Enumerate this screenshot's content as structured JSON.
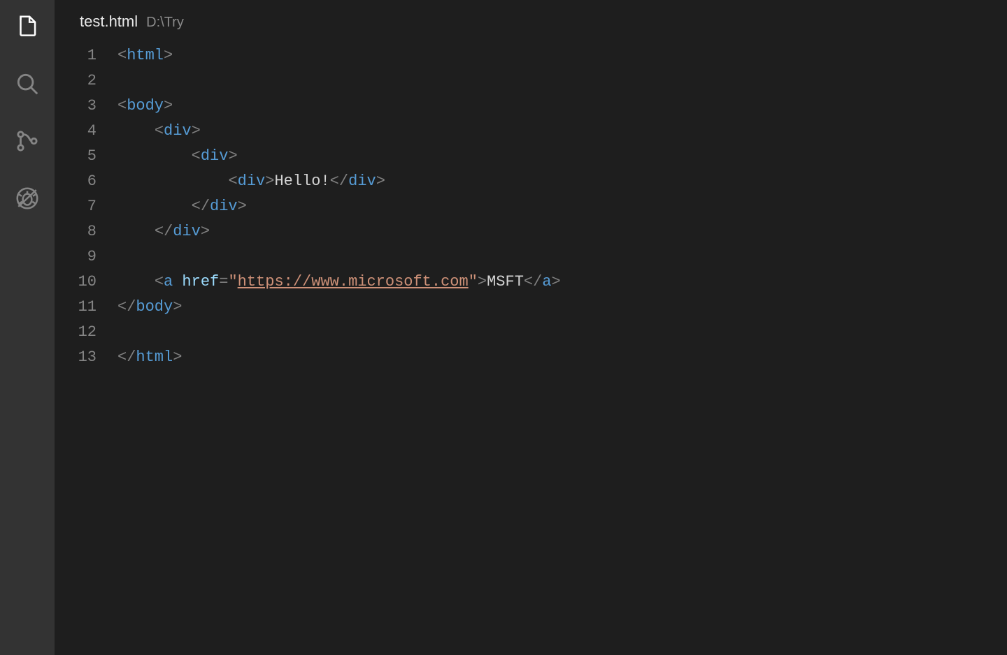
{
  "activityBar": {
    "items": [
      {
        "name": "files-icon",
        "active": true
      },
      {
        "name": "search-icon",
        "active": false
      },
      {
        "name": "scm-icon",
        "active": false
      },
      {
        "name": "debug-icon",
        "active": false
      }
    ]
  },
  "editor": {
    "tab": {
      "filename": "test.html",
      "path": "D:\\Try"
    },
    "lineNumbers": [
      "1",
      "2",
      "3",
      "4",
      "5",
      "6",
      "7",
      "8",
      "9",
      "10",
      "11",
      "12",
      "13"
    ],
    "code": {
      "lines": [
        [
          {
            "t": "p",
            "v": "<"
          },
          {
            "t": "tg",
            "v": "html"
          },
          {
            "t": "p",
            "v": ">"
          }
        ],
        [],
        [
          {
            "t": "p",
            "v": "<"
          },
          {
            "t": "tg",
            "v": "body"
          },
          {
            "t": "p",
            "v": ">"
          }
        ],
        [
          {
            "t": "tx",
            "v": "    "
          },
          {
            "t": "p",
            "v": "<"
          },
          {
            "t": "tg",
            "v": "div"
          },
          {
            "t": "p",
            "v": ">"
          }
        ],
        [
          {
            "t": "tx",
            "v": "        "
          },
          {
            "t": "p",
            "v": "<"
          },
          {
            "t": "tg",
            "v": "div"
          },
          {
            "t": "p",
            "v": ">"
          }
        ],
        [
          {
            "t": "tx",
            "v": "            "
          },
          {
            "t": "p",
            "v": "<"
          },
          {
            "t": "tg",
            "v": "div"
          },
          {
            "t": "p",
            "v": ">"
          },
          {
            "t": "tx",
            "v": "Hello!"
          },
          {
            "t": "p",
            "v": "</"
          },
          {
            "t": "tg",
            "v": "div"
          },
          {
            "t": "p",
            "v": ">"
          }
        ],
        [
          {
            "t": "tx",
            "v": "        "
          },
          {
            "t": "p",
            "v": "</"
          },
          {
            "t": "tg",
            "v": "div"
          },
          {
            "t": "p",
            "v": ">"
          }
        ],
        [
          {
            "t": "tx",
            "v": "    "
          },
          {
            "t": "p",
            "v": "</"
          },
          {
            "t": "tg",
            "v": "div"
          },
          {
            "t": "p",
            "v": ">"
          }
        ],
        [],
        [
          {
            "t": "tx",
            "v": "    "
          },
          {
            "t": "p",
            "v": "<"
          },
          {
            "t": "tg",
            "v": "a"
          },
          {
            "t": "tx",
            "v": " "
          },
          {
            "t": "at",
            "v": "href"
          },
          {
            "t": "p",
            "v": "="
          },
          {
            "t": "st",
            "v": "\""
          },
          {
            "t": "lk",
            "v": "https://www.microsoft.com"
          },
          {
            "t": "st",
            "v": "\""
          },
          {
            "t": "p",
            "v": ">"
          },
          {
            "t": "tx",
            "v": "MSFT"
          },
          {
            "t": "p",
            "v": "</"
          },
          {
            "t": "tg",
            "v": "a"
          },
          {
            "t": "p",
            "v": ">"
          }
        ],
        [
          {
            "t": "p",
            "v": "</"
          },
          {
            "t": "tg",
            "v": "body"
          },
          {
            "t": "p",
            "v": ">"
          }
        ],
        [],
        [
          {
            "t": "p",
            "v": "</"
          },
          {
            "t": "tg",
            "v": "html"
          },
          {
            "t": "p",
            "v": ">"
          }
        ]
      ]
    }
  }
}
